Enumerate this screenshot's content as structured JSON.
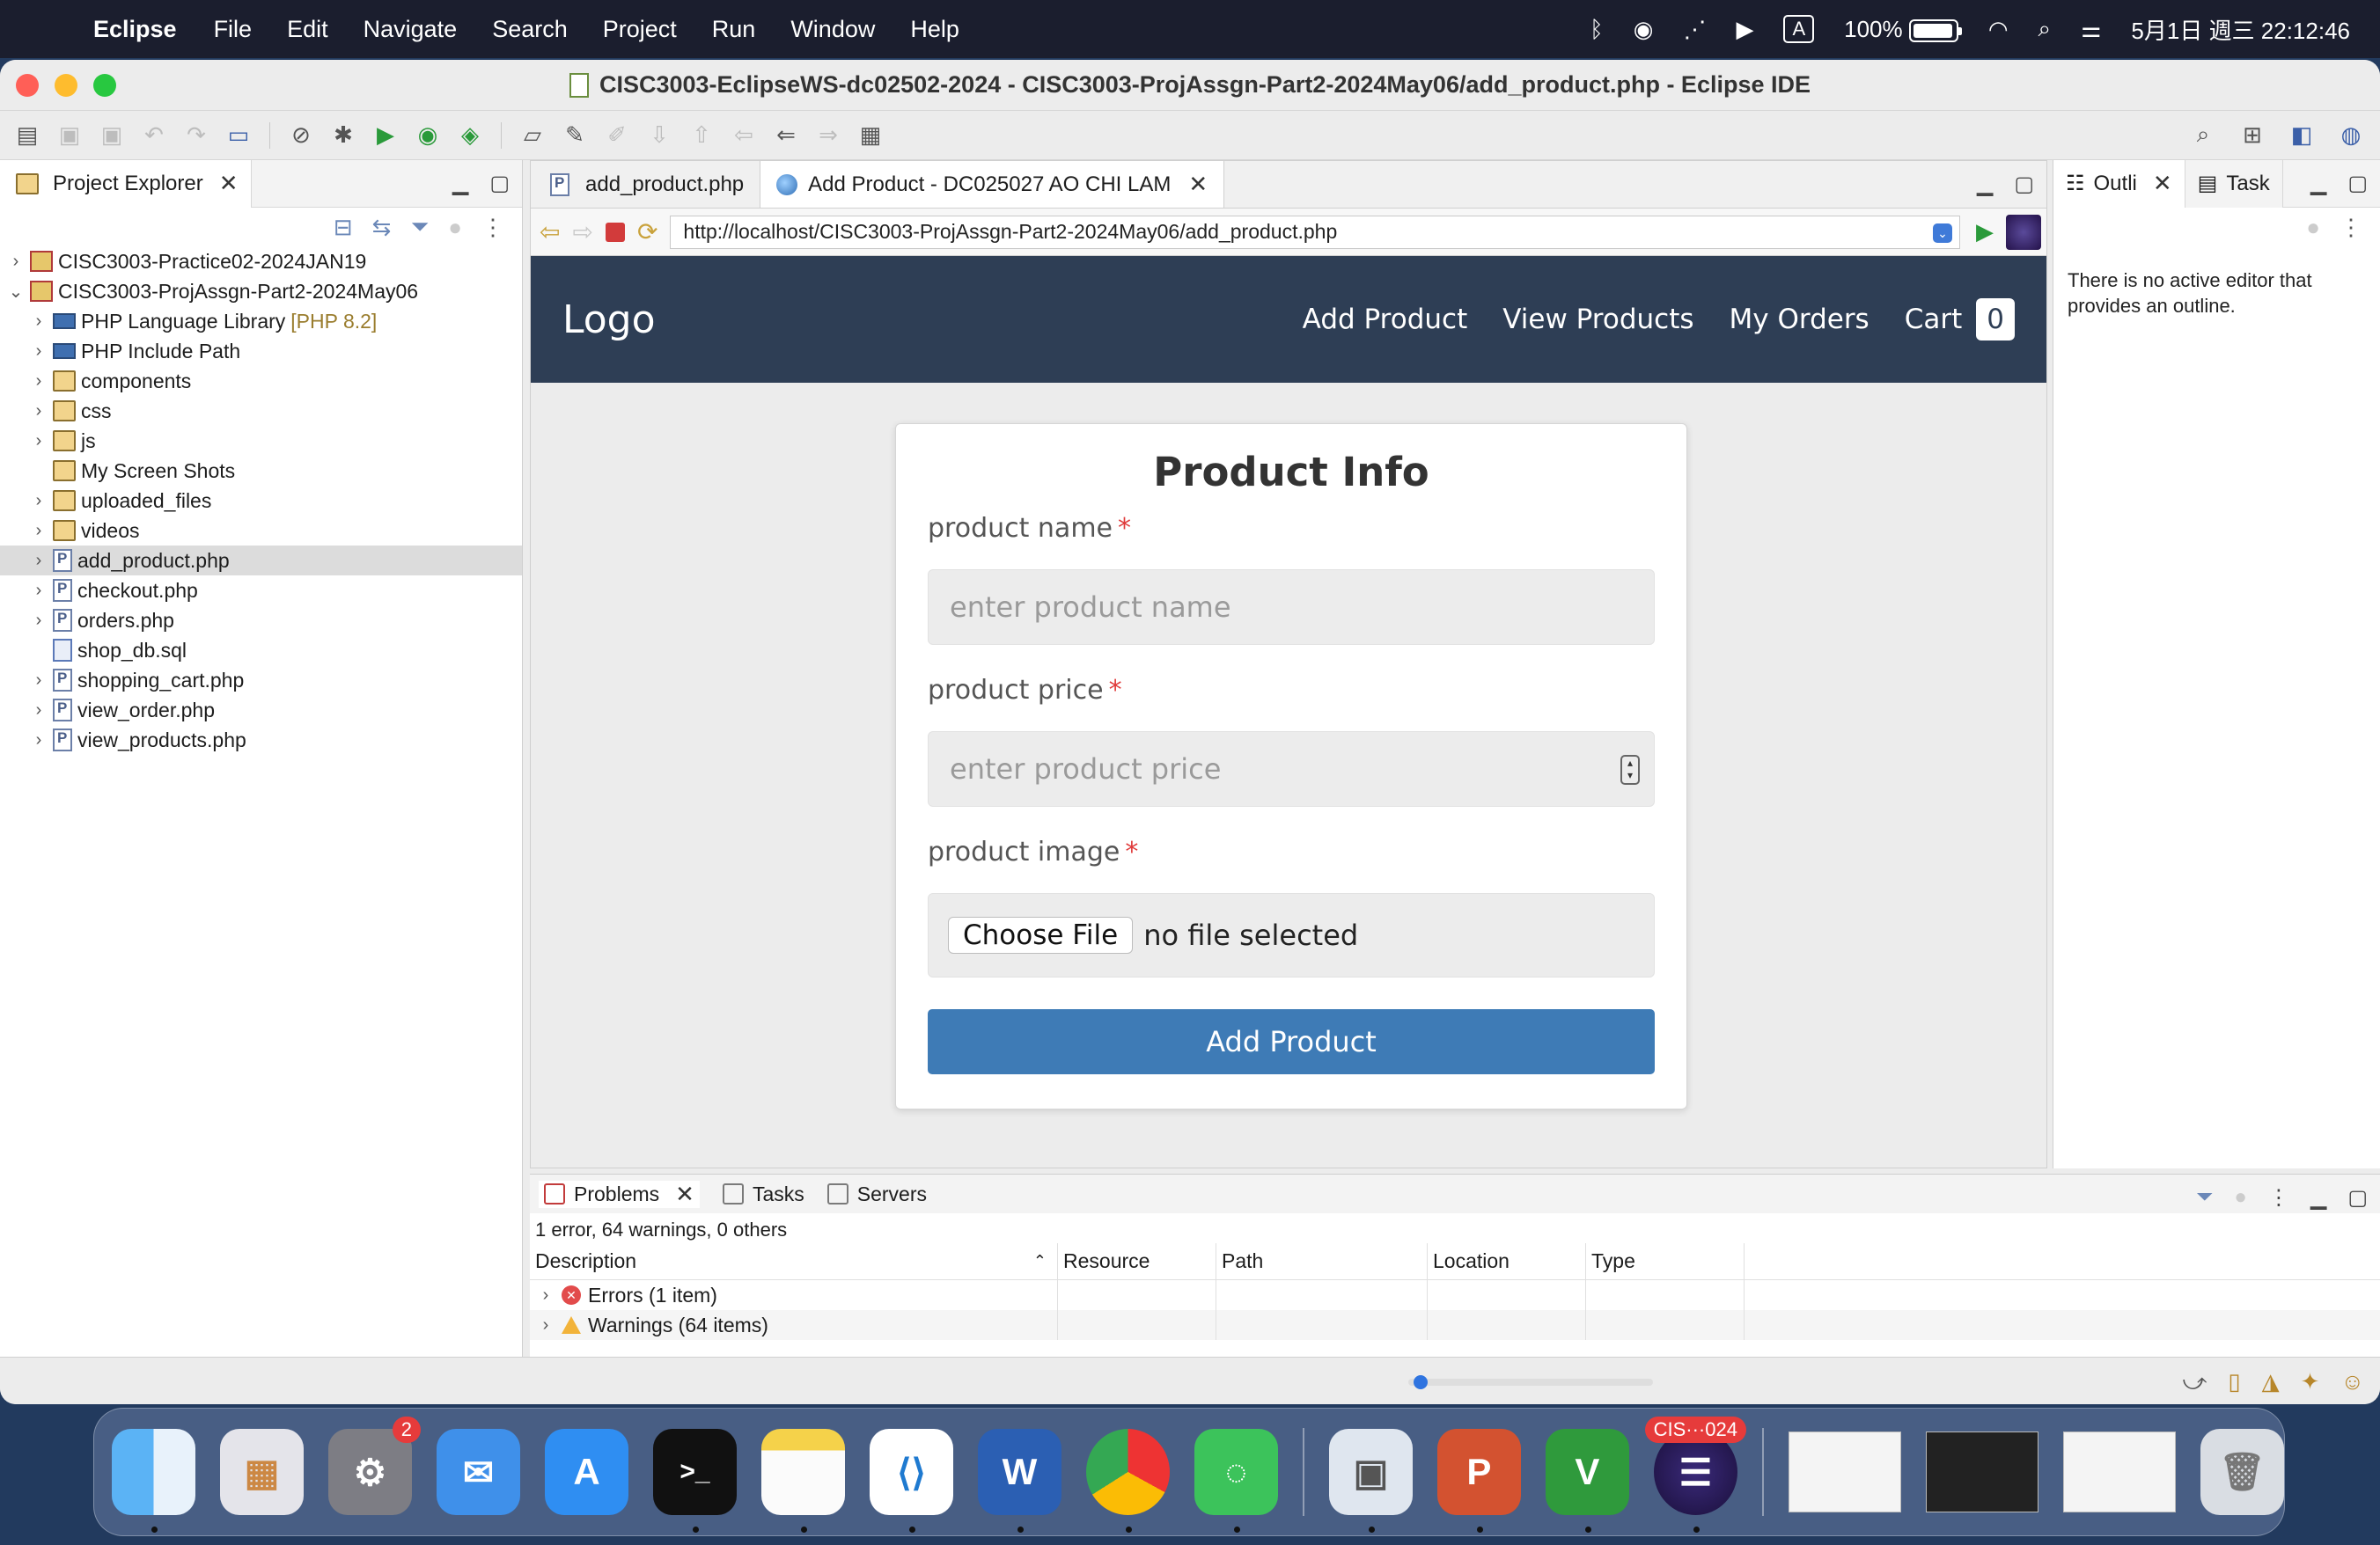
{
  "menubar": {
    "app_name": "Eclipse",
    "items": [
      "File",
      "Edit",
      "Navigate",
      "Search",
      "Project",
      "Run",
      "Window",
      "Help"
    ],
    "input_method": "A",
    "battery": "100%",
    "clock": "5月1日 週三  22:12:46"
  },
  "window": {
    "title": "CISC3003-EclipseWS-dc02502-2024 - CISC3003-ProjAssgn-Part2-2024May06/add_product.php - Eclipse IDE"
  },
  "explorer": {
    "tab_label": "Project Explorer",
    "items": [
      {
        "label": "CISC3003-Practice02-2024JAN19",
        "tag": ""
      },
      {
        "label": "CISC3003-ProjAssgn-Part2-2024May06",
        "tag": ""
      },
      {
        "label": "PHP Language Library",
        "tag": "[PHP 8.2]"
      },
      {
        "label": "PHP Include Path",
        "tag": ""
      },
      {
        "label": "components",
        "tag": ""
      },
      {
        "label": "css",
        "tag": ""
      },
      {
        "label": "js",
        "tag": ""
      },
      {
        "label": "My Screen Shots",
        "tag": ""
      },
      {
        "label": "uploaded_files",
        "tag": ""
      },
      {
        "label": "videos",
        "tag": ""
      },
      {
        "label": "add_product.php",
        "tag": ""
      },
      {
        "label": "checkout.php",
        "tag": ""
      },
      {
        "label": "orders.php",
        "tag": ""
      },
      {
        "label": "shop_db.sql",
        "tag": ""
      },
      {
        "label": "shopping_cart.php",
        "tag": ""
      },
      {
        "label": "view_order.php",
        "tag": ""
      },
      {
        "label": "view_products.php",
        "tag": ""
      }
    ]
  },
  "editor": {
    "tabs": [
      "add_product.php",
      "Add Product - DC025027 AO CHI LAM"
    ],
    "url": "http://localhost/CISC3003-ProjAssgn-Part2-2024May06/add_product.php"
  },
  "site": {
    "logo": "Logo",
    "nav": [
      "Add Product",
      "View Products",
      "My Orders",
      "Cart"
    ],
    "cart_count": "0"
  },
  "form": {
    "title": "Product Info",
    "name_label": "product name",
    "name_placeholder": "enter product name",
    "price_label": "product price",
    "price_placeholder": "enter product price",
    "image_label": "product image",
    "choose_file": "Choose File",
    "no_file": "no file selected",
    "submit": "Add Product",
    "required_mark": "*"
  },
  "outline": {
    "tabs": [
      "Outli",
      "Task"
    ],
    "message": "There is no active editor that provides an outline."
  },
  "problems": {
    "tabs": [
      "Problems",
      "Tasks",
      "Servers"
    ],
    "summary": "1 error, 64 warnings, 0 others",
    "columns": [
      "Description",
      "Resource",
      "Path",
      "Location",
      "Type"
    ],
    "rows": [
      "Errors (1 item)",
      "Warnings (64 items)"
    ]
  },
  "progress": {
    "fraction": 0.02
  },
  "dock": {
    "settings_badge": "2",
    "eclipse_badge": "CIS···024"
  },
  "colors": {
    "site_nav": "#2e3e55",
    "submit_button": "#3e7bb6",
    "required": "#e03b3b"
  }
}
